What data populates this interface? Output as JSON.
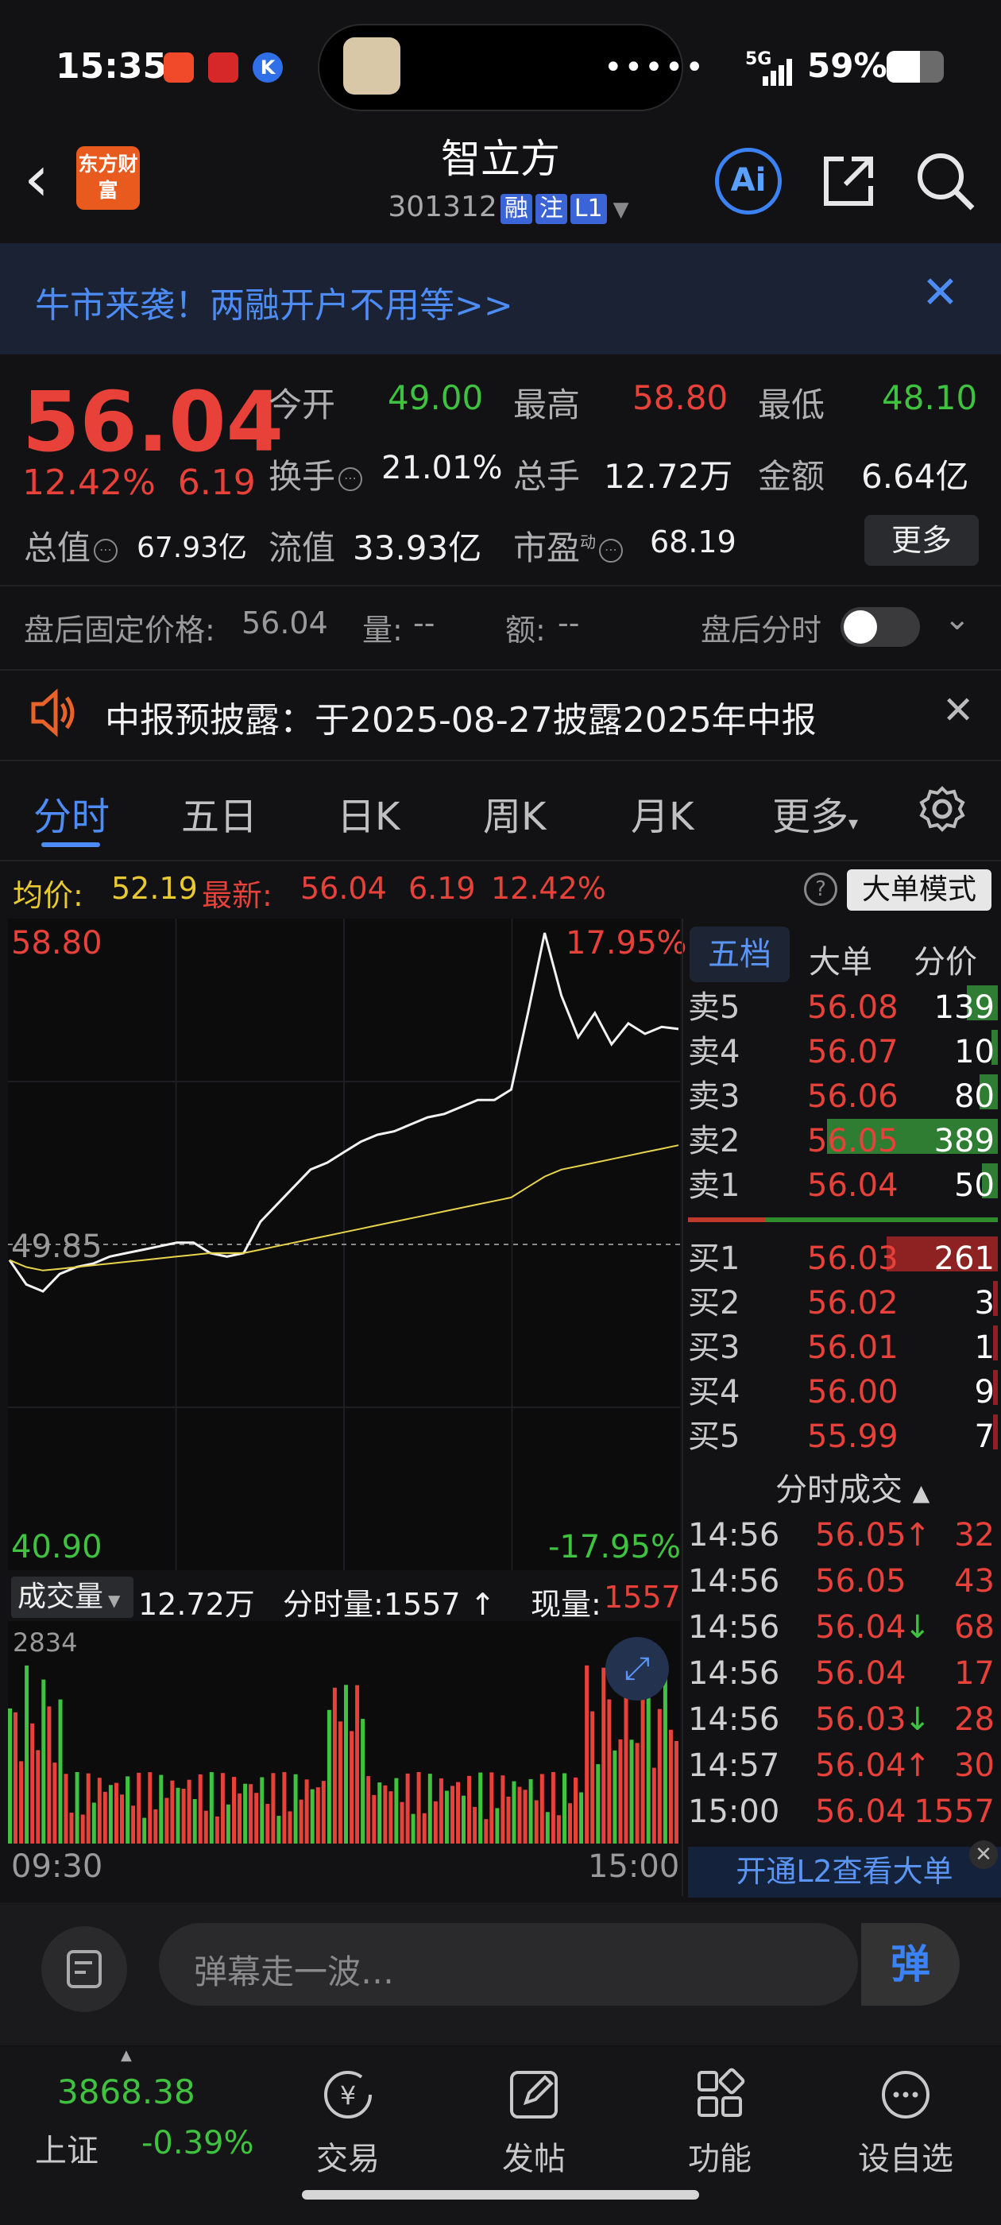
{
  "status": {
    "time": "15:35",
    "network": "5G",
    "battery": "59%",
    "battery_level": 0.59
  },
  "header": {
    "name": "智立方",
    "code": "301312",
    "tags": [
      "融",
      "注",
      "L1"
    ],
    "logo_text": "东方财富",
    "ai_label": "Ai"
  },
  "banner": {
    "text": "牛市来袭！两融开户不用等>>"
  },
  "quote": {
    "price": "56.04",
    "change_pct": "12.42%",
    "change": "6.19",
    "open_label": "今开",
    "open": "49.00",
    "high_label": "最高",
    "high": "58.80",
    "low_label": "最低",
    "low": "48.10",
    "turnover_label": "换手",
    "turnover": "21.01%",
    "volume_label": "总手",
    "volume": "12.72万",
    "amount_label": "金额",
    "amount": "6.64亿",
    "mktcap_label": "总值",
    "mktcap": "67.93亿",
    "float_label": "流值",
    "float": "33.93亿",
    "pe_label": "市盈",
    "pe_sup": "动",
    "pe": "68.19",
    "more_label": "更多"
  },
  "after_hours": {
    "price_label": "盘后固定价格:",
    "price": "56.04",
    "vol_label": "量:",
    "vol": "--",
    "amt_label": "额:",
    "amt": "--",
    "toggle_label": "盘后分时"
  },
  "notice": {
    "text": "中报预披露：于2025-08-27披露2025年中报"
  },
  "tabs": [
    "分时",
    "五日",
    "日K",
    "周K",
    "月K",
    "更多"
  ],
  "chart_header": {
    "avg_label": "均价:",
    "avg": "52.19",
    "last_label": "最新:",
    "last": "56.04",
    "chg": "6.19",
    "pct": "12.42%",
    "mode_label": "大单模式"
  },
  "chart_data": {
    "type": "line",
    "y_top": "58.80",
    "y_mid": "49.85",
    "y_bottom": "40.90",
    "pct_top": "17.95%",
    "pct_bottom": "-17.95%",
    "x_start": "09:30",
    "x_end": "15:00",
    "ylim": [
      40.9,
      58.8
    ],
    "series": [
      {
        "values": [
          49.4,
          48.7,
          48.5,
          49.0,
          49.2,
          49.3,
          49.5,
          49.6,
          49.7,
          49.8,
          49.9,
          49.9,
          49.6,
          49.5,
          49.6,
          50.5,
          51.0,
          51.5,
          52.0,
          52.2,
          52.5,
          52.8,
          53.0,
          53.1,
          53.3,
          53.5,
          53.6,
          53.8,
          54.0,
          54.0,
          54.3,
          56.5,
          58.8,
          57.0,
          55.8,
          56.5,
          55.6,
          56.2,
          55.9,
          56.1,
          56.04
        ]
      },
      {
        "values": [
          49.4,
          49.2,
          49.1,
          49.15,
          49.2,
          49.25,
          49.3,
          49.35,
          49.4,
          49.45,
          49.5,
          49.55,
          49.6,
          49.6,
          49.6,
          49.7,
          49.8,
          49.9,
          50.0,
          50.1,
          50.2,
          50.3,
          50.4,
          50.5,
          50.6,
          50.7,
          50.8,
          50.9,
          51.0,
          51.1,
          51.2,
          51.5,
          51.8,
          52.0,
          52.1,
          52.2,
          52.3,
          52.4,
          52.5,
          52.6,
          52.7
        ]
      }
    ]
  },
  "volume": {
    "label": "成交量",
    "total": "12.72万",
    "tick_label": "分时量:1557",
    "cur_label": "现量:",
    "cur": "1557",
    "max": "2834"
  },
  "orderbook": {
    "tabs": [
      "五档",
      "大单",
      "分价"
    ],
    "asks": [
      {
        "label": "卖5",
        "price": "56.08",
        "vol": "139",
        "ratio": 0.1
      },
      {
        "label": "卖4",
        "price": "56.07",
        "vol": "10",
        "ratio": 0.02
      },
      {
        "label": "卖3",
        "price": "56.06",
        "vol": "80",
        "ratio": 0.06
      },
      {
        "label": "卖2",
        "price": "56.05",
        "vol": "389",
        "ratio": 0.55
      },
      {
        "label": "卖1",
        "price": "56.04",
        "vol": "50",
        "ratio": 0.05
      }
    ],
    "bids": [
      {
        "label": "买1",
        "price": "56.03",
        "vol": "261",
        "ratio": 0.36
      },
      {
        "label": "买2",
        "price": "56.02",
        "vol": "3",
        "ratio": 0.01
      },
      {
        "label": "买3",
        "price": "56.01",
        "vol": "1",
        "ratio": 0.01
      },
      {
        "label": "买4",
        "price": "56.00",
        "vol": "9",
        "ratio": 0.01
      },
      {
        "label": "买5",
        "price": "55.99",
        "vol": "7",
        "ratio": 0.01
      }
    ],
    "ticks_title": "分时成交",
    "ticks": [
      {
        "time": "14:56",
        "price": "56.05",
        "arrow": "↑",
        "vol": "32"
      },
      {
        "time": "14:56",
        "price": "56.05",
        "arrow": "",
        "vol": "43"
      },
      {
        "time": "14:56",
        "price": "56.04",
        "arrow": "↓",
        "vol": "68"
      },
      {
        "time": "14:56",
        "price": "56.04",
        "arrow": "",
        "vol": "17"
      },
      {
        "time": "14:56",
        "price": "56.03",
        "arrow": "↓",
        "vol": "28"
      },
      {
        "time": "14:57",
        "price": "56.04",
        "arrow": "↑",
        "vol": "30"
      },
      {
        "time": "15:00",
        "price": "56.04",
        "arrow": "",
        "vol": "1557"
      }
    ],
    "l2_label": "开通L2查看大单"
  },
  "comment": {
    "placeholder": "弹幕走一波…",
    "send_label": "弹"
  },
  "bottom_nav": {
    "index_value": "3868.38",
    "index_name": "上证",
    "index_change": "-0.39%",
    "items": [
      "交易",
      "发帖",
      "功能",
      "设自选"
    ]
  },
  "colors": {
    "up": "#e8413a",
    "down": "#3fc23f",
    "accent": "#4d8cf6",
    "bg": "#121214"
  }
}
